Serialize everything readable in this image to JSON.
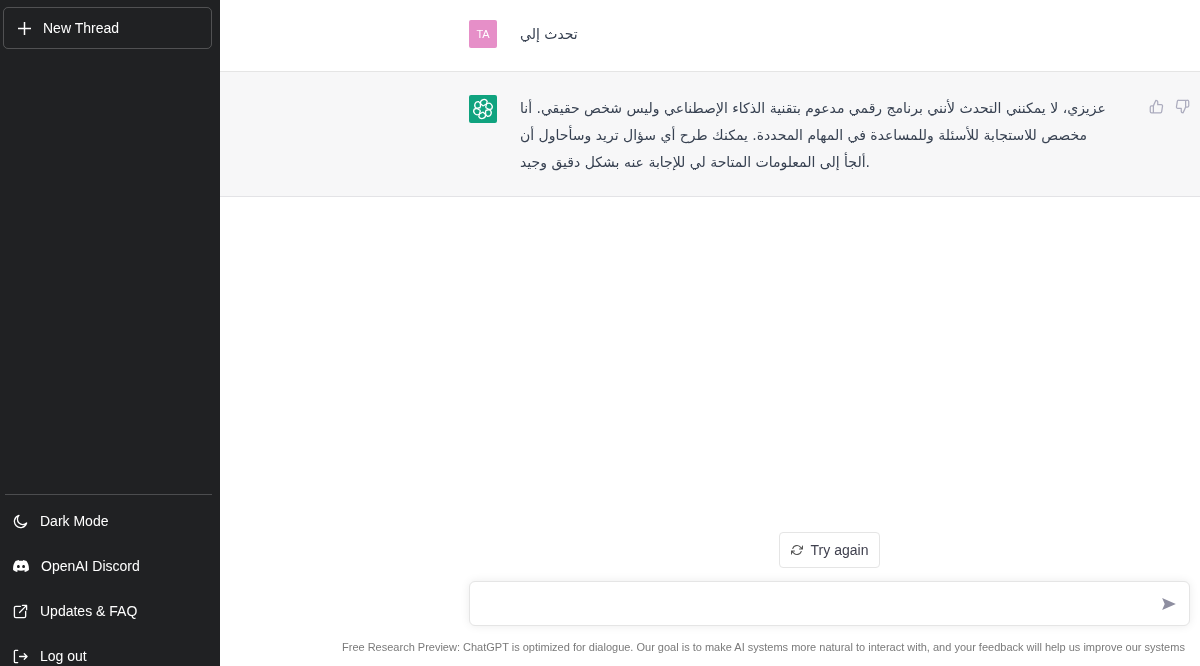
{
  "sidebar": {
    "new_thread": {
      "label": "New Thread"
    },
    "items": [
      {
        "label": "Dark Mode"
      },
      {
        "label": "OpenAI Discord"
      },
      {
        "label": "Updates & FAQ"
      },
      {
        "label": "Log out"
      }
    ]
  },
  "messages": [
    {
      "kind": "user",
      "avatar": "TA",
      "text": "تحدث إلي"
    },
    {
      "kind": "assistant",
      "text": "عزيزي، لا يمكنني التحدث لأنني برنامج رقمي مدعوم بتقنية الذكاء الإصطناعي وليس شخص حقيقي. أنا مخصص للاستجابة للأسئلة وللمساعدة في المهام المحددة. يمكنك طرح أي سؤال تريد وسأحاول أن ألجأ إلى المعلومات المتاحة لي للإجابة عنه بشكل دقيق وجيد."
    }
  ],
  "try_again": {
    "label": "Try again"
  },
  "footer": "Free Research Preview: ChatGPT is optimized for dialogue. Our goal is to make AI systems more natural to interact with, and your feedback will help us improve our systems"
}
